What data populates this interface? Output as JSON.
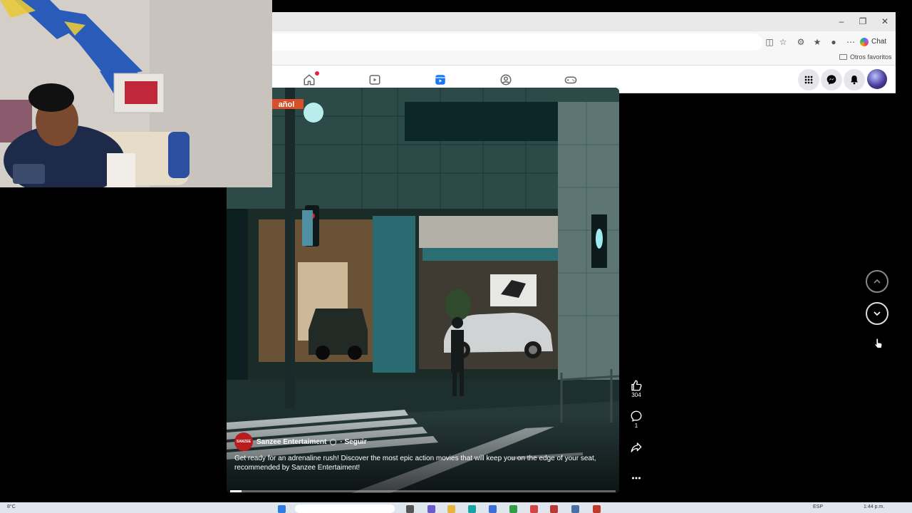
{
  "browser": {
    "chat_label": "Chat",
    "favorites_folder": "Otros favoritos",
    "window_controls": [
      "minimize-icon",
      "maximize-icon",
      "close-icon"
    ]
  },
  "facebook_nav": {
    "tabs": [
      {
        "name": "home",
        "icon": "home-icon",
        "has_notification": true
      },
      {
        "name": "video",
        "icon": "video-icon",
        "has_notification": false
      },
      {
        "name": "reels",
        "icon": "reels-icon",
        "active": true
      },
      {
        "name": "groups",
        "icon": "groups-icon",
        "has_notification": false
      },
      {
        "name": "gaming",
        "icon": "gaming-icon",
        "has_notification": false
      }
    ],
    "right_icons": [
      "menu-grid-icon",
      "messenger-icon",
      "bell-icon",
      "profile-avatar"
    ],
    "accent_color": "#1877f2"
  },
  "reel": {
    "creator": {
      "avatar_text": "SANZEE",
      "name": "Sanzee Entertaiment",
      "follow_label": "· Seguir"
    },
    "caption": "Get ready for an adrenaline rush! Discover the most epic action movies that will keep you on the edge of your seat, recommended by Sanzee Entertaiment!",
    "overlay_tag": "añol",
    "progress": 0.03,
    "actions": {
      "likes": "304",
      "comments": "1"
    }
  },
  "taskbar": {
    "temperature": "8°C",
    "language": "ESP",
    "time": "1:44 p.m."
  }
}
